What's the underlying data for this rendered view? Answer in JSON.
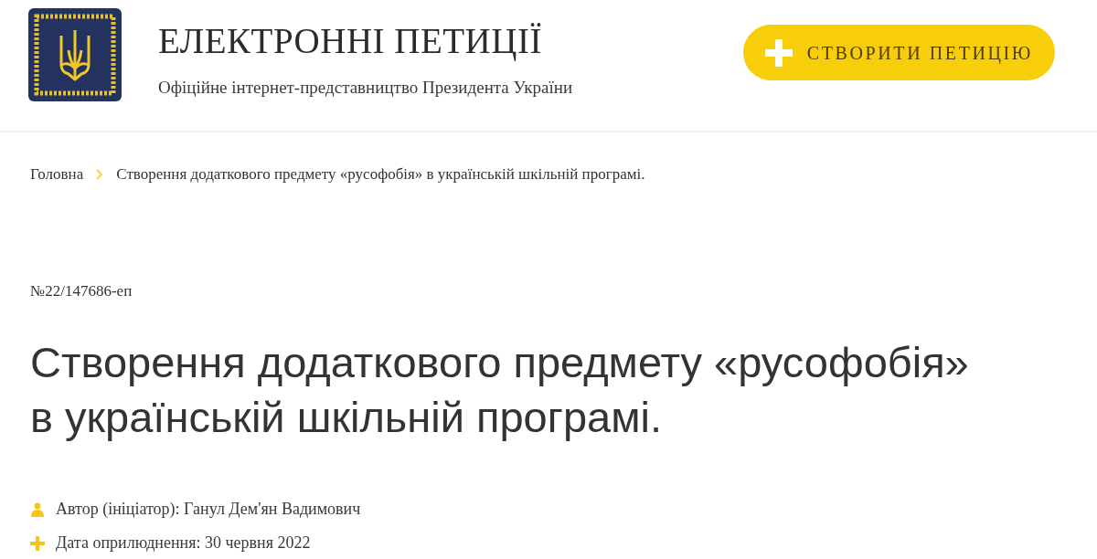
{
  "header": {
    "title": "ЕЛЕКТРОННІ ПЕТИЦІЇ",
    "subtitle": "Офіційне інтернет-представництво Президента України",
    "create_button": "СТВОРИТИ ПЕТИЦІЮ"
  },
  "breadcrumb": [
    {
      "label": "Головна"
    },
    {
      "label": "Створення додаткового предмету «русофобія» в українській шкільній програмі."
    }
  ],
  "petition": {
    "number": "№22/147686-еп",
    "title_lines": [
      "Створення додаткового предмету «русофобія»",
      "в українській шкільній програмі."
    ],
    "meta": [
      {
        "kind": "author",
        "text": "Автор (ініціатор): Ганул Дем'ян Вадимович"
      },
      {
        "kind": "date",
        "text": "Дата оприлюднення: 30 червня 2022"
      }
    ]
  }
}
